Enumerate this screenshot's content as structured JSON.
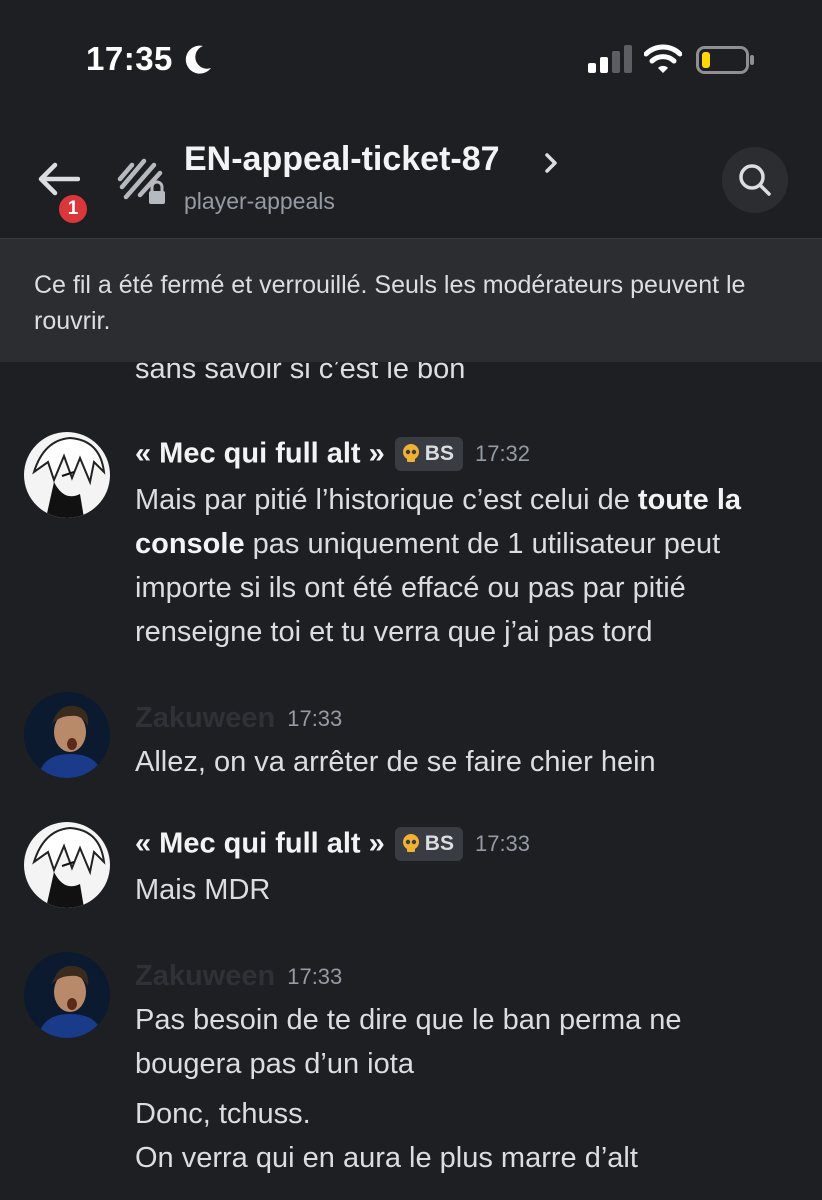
{
  "status_bar": {
    "time": "17:35"
  },
  "header": {
    "back_badge": "1",
    "title": "EN-appeal-ticket-87",
    "subtitle": "player-appeals"
  },
  "banner": {
    "text": "Ce fil a été fermé et verrouillé. Seuls les modérateurs peuvent le rouvrir."
  },
  "partial_message": "sans savoir si c’est le bon",
  "messages": [
    {
      "author": "« Mec qui full alt »",
      "tag": "BS",
      "time": "17:32",
      "body_before": "Mais par pitié l’historique c’est celui de ",
      "body_bold": "toute la console",
      "body_after": " pas uniquement de 1 utilisateur peut importe si ils ont été effacé ou pas par pitié renseigne toi et tu verra que j’ai pas tord"
    },
    {
      "author": "Zakuween",
      "time": "17:33",
      "body": "Allez, on va arrêter de se faire chier hein"
    },
    {
      "author": "« Mec qui full alt »",
      "tag": "BS",
      "time": "17:33",
      "body": "Mais MDR"
    },
    {
      "author": "Zakuween",
      "time": "17:33",
      "body": "Pas besoin de te dire que le ban perma ne bougera pas d’un iota",
      "body2": "Donc, tchuss.",
      "body3": "On verra qui en aura le plus marre d’alt"
    }
  ]
}
